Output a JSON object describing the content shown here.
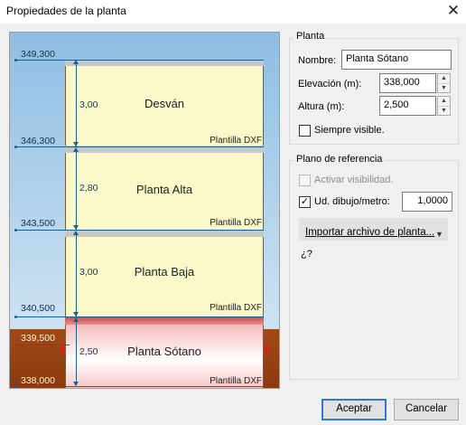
{
  "window": {
    "title": "Propiedades de la planta",
    "close_glyph": "✕"
  },
  "diagram": {
    "floors": [
      {
        "name": "Desván",
        "height": "3,00",
        "template": "Plantilla DXF"
      },
      {
        "name": "Planta Alta",
        "height": "2,80",
        "template": "Plantilla DXF"
      },
      {
        "name": "Planta Baja",
        "height": "3,00",
        "template": "Plantilla DXF"
      },
      {
        "name": "Planta Sótano",
        "height": "2,50",
        "template": "Plantilla DXF"
      }
    ],
    "elevations": [
      "349,300",
      "346,300",
      "343,500",
      "340,500",
      "339,500",
      "338,000"
    ],
    "colors": {
      "sky": "#a9cde9",
      "ground": "#8a3a0f",
      "floor": "#fbf8c9",
      "selected_slab": "#d04d4d",
      "dimension": "#1b5f8c",
      "marker": "#d81f1f"
    }
  },
  "planta_group": {
    "title": "Planta",
    "nombre_label": "Nombre:",
    "nombre_value": "Planta Sótano",
    "elevacion_label": "Elevación (m):",
    "elevacion_value": "338,000",
    "altura_label": "Altura (m):",
    "altura_value": "2,500",
    "siempre_visible_label": "Siempre visible.",
    "siempre_visible_checked": false
  },
  "referencia_group": {
    "title": "Plano de referencia",
    "activar_label": "Activar visibilidad.",
    "activar_checked": true,
    "activar_enabled": false,
    "ud_label": "Ud. dibujo/metro:",
    "ud_checked": true,
    "ud_value": "1,0000",
    "importar_label": "Importar archivo de planta...",
    "help_text": "¿?"
  },
  "buttons": {
    "aceptar": "Aceptar",
    "cancelar": "Cancelar"
  },
  "icons": {
    "spin_up": "▲",
    "spin_down": "▼",
    "dropdown": "chevron-down-icon",
    "checkmark": "✓"
  }
}
